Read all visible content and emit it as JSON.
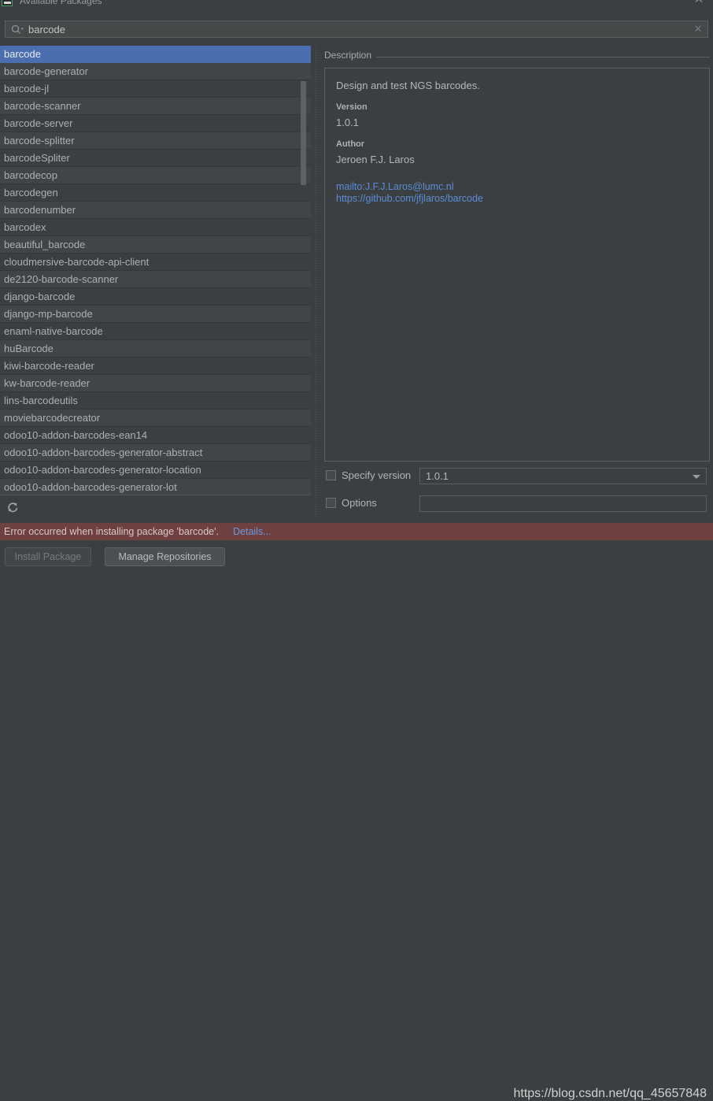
{
  "window": {
    "title": "Available Packages",
    "icon": "package-icon",
    "close_label": "✕"
  },
  "search": {
    "icon": "search-icon",
    "value": "barcode",
    "placeholder": "",
    "clear_label": "✕"
  },
  "package_list": {
    "selected_index": 0,
    "refresh_icon": "refresh-icon",
    "items": [
      "barcode",
      "barcode-generator",
      "barcode-jl",
      "barcode-scanner",
      "barcode-server",
      "barcode-splitter",
      "barcodeSpliter",
      "barcodecop",
      "barcodegen",
      "barcodenumber",
      "barcodex",
      "beautiful_barcode",
      "cloudmersive-barcode-api-client",
      "de2120-barcode-scanner",
      "django-barcode",
      "django-mp-barcode",
      "enaml-native-barcode",
      "huBarcode",
      "kiwi-barcode-reader",
      "kw-barcode-reader",
      "lins-barcodeutils",
      "moviebarcodecreator",
      "odoo10-addon-barcodes-ean14",
      "odoo10-addon-barcodes-generator-abstract",
      "odoo10-addon-barcodes-generator-location",
      "odoo10-addon-barcodes-generator-lot"
    ]
  },
  "description": {
    "legend": "Description",
    "summary": "Design and test NGS barcodes.",
    "version_label": "Version",
    "version_value": "1.0.1",
    "author_label": "Author",
    "author_value": "Jeroen F.J. Laros",
    "links": [
      "mailto:J.F.J.Laros@lumc.nl",
      "https://github.com/jfjlaros/barcode"
    ]
  },
  "options": {
    "specify_version_label": "Specify version",
    "specify_version_checked": false,
    "version_selected": "1.0.1",
    "options_label": "Options",
    "options_checked": false,
    "options_value": "",
    "options_placeholder": ""
  },
  "error": {
    "message": "Error occurred when installing package 'barcode'.",
    "details_label": "Details..."
  },
  "buttons": {
    "install": "Install Package",
    "install_disabled": true,
    "manage": "Manage Repositories"
  },
  "watermark": "https://blog.csdn.net/qq_45657848",
  "colors": {
    "background": "#3c3f41",
    "selection": "#4b6eaf",
    "link": "#5b8ed6",
    "error_bar": "#6e4040",
    "border": "#5a5e60"
  }
}
